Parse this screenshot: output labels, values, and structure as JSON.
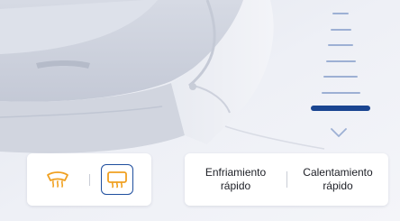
{
  "colors": {
    "accent": "#1a4591",
    "inactive_level": "#9db0d4",
    "defrost_icon": "#f0a020",
    "panel_bg": "#ffffff"
  },
  "fan_level": {
    "steps": 7,
    "selected_step": 1,
    "down_icon": "chevron-down-icon"
  },
  "defrost": {
    "front_icon": "windshield-defrost-icon",
    "rear_icon": "rear-window-defrost-icon",
    "rear_selected": true
  },
  "modes": {
    "cool": {
      "line1": "Enfriamiento",
      "line2": "rápido"
    },
    "heat": {
      "line1": "Calentamiento",
      "line2": "rápido"
    }
  }
}
